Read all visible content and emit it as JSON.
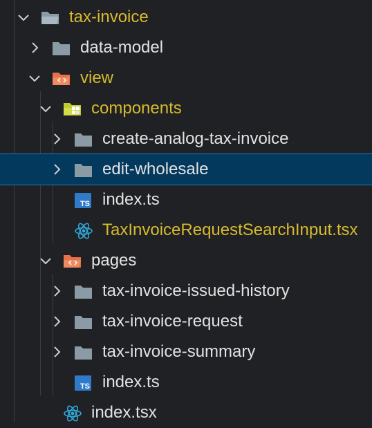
{
  "explorer": {
    "items": [
      {
        "label": "tax-invoice",
        "icon": "folder-open-icon"
      },
      {
        "label": "data-model",
        "icon": "folder-icon"
      },
      {
        "label": "view",
        "icon": "folder-view-open-icon"
      },
      {
        "label": "components",
        "icon": "folder-components-open-icon"
      },
      {
        "label": "create-analog-tax-invoice",
        "icon": "folder-icon"
      },
      {
        "label": "edit-wholesale",
        "icon": "folder-icon"
      },
      {
        "label": "index.ts",
        "icon": "typescript-file-icon",
        "badge": "TS"
      },
      {
        "label": "TaxInvoiceRequestSearchInput.tsx",
        "icon": "react-file-icon"
      },
      {
        "label": "pages",
        "icon": "folder-view-open-icon"
      },
      {
        "label": "tax-invoice-issued-history",
        "icon": "folder-icon"
      },
      {
        "label": "tax-invoice-request",
        "icon": "folder-icon"
      },
      {
        "label": "tax-invoice-summary",
        "icon": "folder-icon"
      },
      {
        "label": "index.ts",
        "icon": "typescript-file-icon",
        "badge": "TS"
      },
      {
        "label": "index.tsx",
        "icon": "react-file-icon"
      }
    ],
    "selected_item": "edit-wholesale"
  },
  "colors": {
    "background": "#202124",
    "selected_background": "#04395e",
    "selected_border": "#1b7cc0",
    "modified_text": "#d7ba2e",
    "folder_grey": "#8a9ba6",
    "folder_orange": "#e8714a",
    "typescript_blue": "#2f7ac9",
    "react_blue": "#2fa8d9"
  }
}
